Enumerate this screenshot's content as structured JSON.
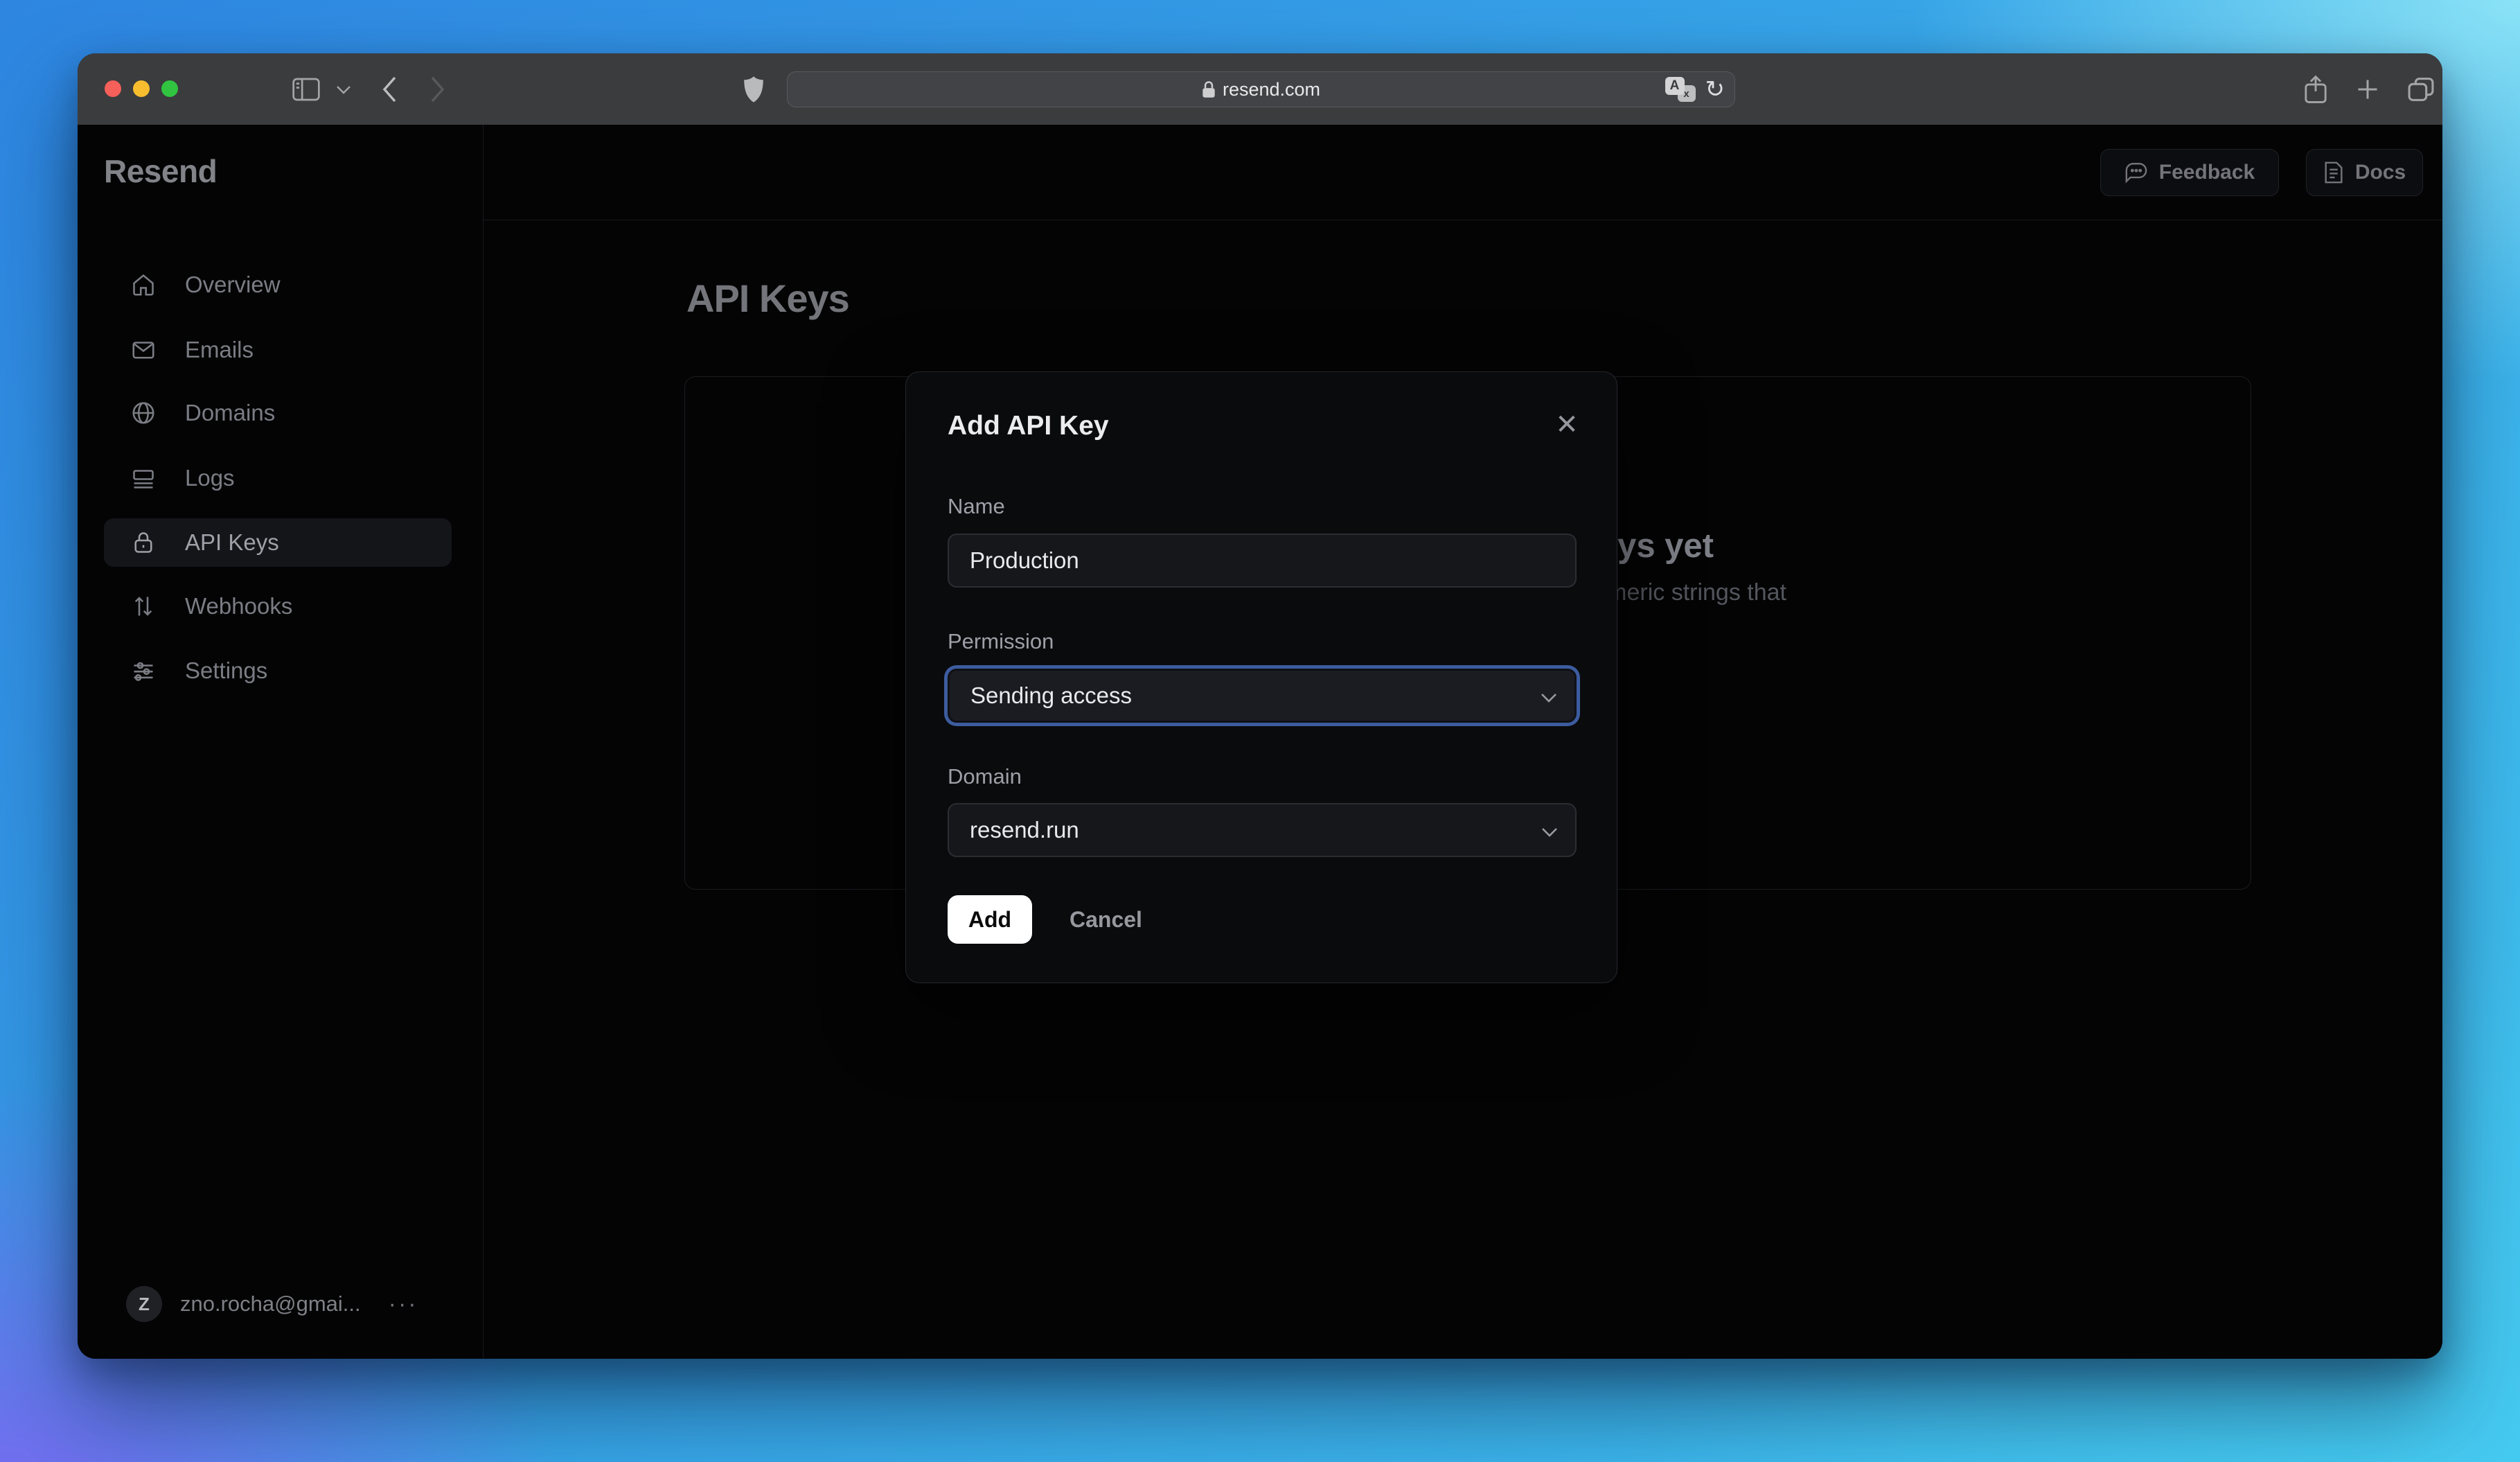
{
  "browser": {
    "url": "resend.com",
    "translate_primary": "A",
    "translate_secondary": "x"
  },
  "icons": {
    "reload": "↻",
    "plus": "+",
    "close": "✕",
    "ellipsis_menu": "···"
  },
  "sidebar": {
    "logo": "Resend",
    "items": [
      {
        "label": "Overview",
        "icon": "home-icon",
        "active": false
      },
      {
        "label": "Emails",
        "icon": "mail-icon",
        "active": false
      },
      {
        "label": "Domains",
        "icon": "globe-icon",
        "active": false
      },
      {
        "label": "Logs",
        "icon": "logs-icon",
        "active": false
      },
      {
        "label": "API Keys",
        "icon": "lock-icon",
        "active": true
      },
      {
        "label": "Webhooks",
        "icon": "webhooks-icon",
        "active": false
      },
      {
        "label": "Settings",
        "icon": "sliders-icon",
        "active": false
      }
    ],
    "account": {
      "initial": "Z",
      "email": "zno.rocha@gmai..."
    }
  },
  "header": {
    "feedback_label": "Feedback",
    "docs_label": "Docs"
  },
  "main": {
    "title": "API Keys",
    "empty_heading": "No API Keys yet",
    "empty_description": "API keys are unique alphanumeric strings that"
  },
  "modal": {
    "title": "Add API Key",
    "name_label": "Name",
    "name_value": "Production",
    "permission_label": "Permission",
    "permission_value": "Sending access",
    "domain_label": "Domain",
    "domain_value": "resend.run",
    "add_label": "Add",
    "cancel_label": "Cancel"
  },
  "colors": {
    "focus_ring": "#3d5c9f",
    "traffic_red": "#f5605a",
    "traffic_yellow": "#f8bd2f",
    "traffic_green": "#30c441",
    "bg_gradient_blue": "#2e86e1",
    "bg_gradient_cyan": "#46cbf2",
    "bg_gradient_purple": "#7a68f0"
  }
}
